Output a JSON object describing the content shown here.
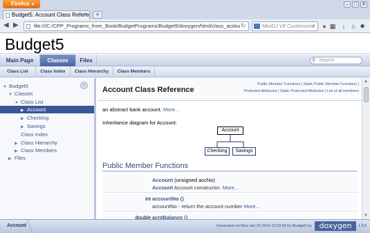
{
  "browser": {
    "app_button": "Firefox",
    "tab_title": "Budget5: Account Class Reference",
    "new_tab": "+",
    "url": "file:///C:/CPP_Programs_from_Book/BudgetPrograms/Budget5/doxygen/html/class_accou",
    "search_placeholder": "MixiDJ V8 Customized",
    "win_min": "–",
    "win_max": "□",
    "win_close": "✕"
  },
  "project": {
    "name": "Budget5"
  },
  "main_tabs": [
    {
      "label": "Main Page"
    },
    {
      "label": "Classes"
    },
    {
      "label": "Files"
    }
  ],
  "search": {
    "placeholder": "Search"
  },
  "sub_tabs": [
    {
      "label": "Class List"
    },
    {
      "label": "Class Index"
    },
    {
      "label": "Class Hierarchy"
    },
    {
      "label": "Class Members"
    }
  ],
  "tree": [
    {
      "label": "Budget5",
      "arrow": "▼"
    },
    {
      "label": "Classes",
      "arrow": "▼"
    },
    {
      "label": "Class List",
      "arrow": "▼"
    },
    {
      "label": "Account",
      "arrow": "▶"
    },
    {
      "label": "Checking",
      "arrow": "▶"
    },
    {
      "label": "Savings",
      "arrow": "▶"
    },
    {
      "label": "Class Index",
      "arrow": ""
    },
    {
      "label": "Class Hierarchy",
      "arrow": "▶"
    },
    {
      "label": "Class Members",
      "arrow": "▶"
    },
    {
      "label": "Files",
      "arrow": "▶"
    }
  ],
  "sync_glyph": "⇔",
  "content": {
    "summary_link1": "Public Member Functions",
    "summary_sep1": " | ",
    "summary_link2": "Static Public Member Functions",
    "summary_sep2": " |",
    "summary_link3": "Protected Attributes",
    "summary_sep3": " | ",
    "summary_link4": "Static Protected Attributes",
    "summary_sep4": " | ",
    "summary_link5": "List of all members",
    "title": "Account Class Reference",
    "brief": "an abstract bank account.",
    "more": "More...",
    "inheritance_label": "Inheritance diagram for Account:",
    "diagram": {
      "base": "Account",
      "derived": [
        "Checking",
        "Savings"
      ]
    },
    "group_header": "Public Member Functions",
    "members": [
      {
        "type": "",
        "name": "Account",
        "args": " (unsigned accNo)",
        "desc": "Account constructor.",
        "desc_prefix": "Account",
        "more": "More..."
      },
      {
        "type": "int",
        "name": "accountNo",
        "args": " ()",
        "desc": "accountNo - return the account number",
        "desc_prefix": "",
        "more": "More..."
      },
      {
        "type": "double",
        "name": "acntBalance",
        "args": " ()",
        "desc": "",
        "desc_prefix": "",
        "more": ""
      }
    ]
  },
  "footer": {
    "breadcrumb": "Account",
    "generated": "Generated on Mon Jan 20 2014 15:53:03 for Budget5 by",
    "logo": "doxygen",
    "version": "1.8.6"
  }
}
